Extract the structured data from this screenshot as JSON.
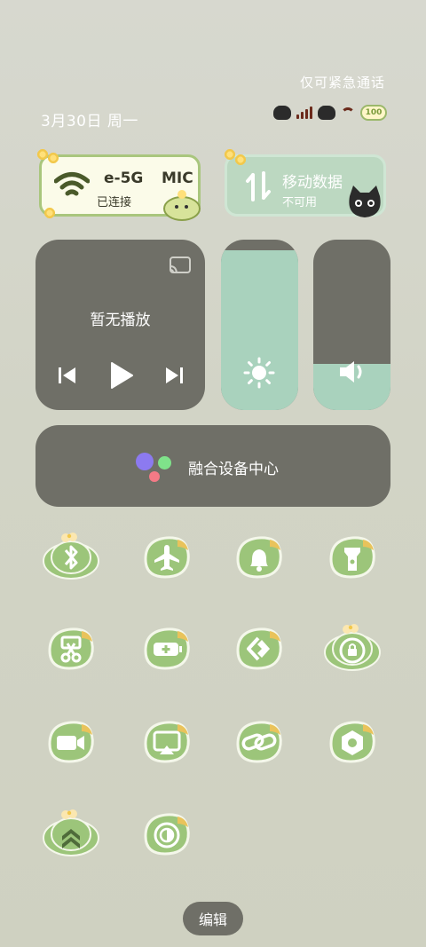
{
  "status_bar": {
    "emergency_text": "仅可紧急通话",
    "date_text": "3月30日 周一",
    "battery_text": "100"
  },
  "wifi_card": {
    "network_name": "e-5G",
    "trailing_text": "MIC",
    "status": "已连接"
  },
  "data_card": {
    "title": "移动数据",
    "status": "不可用"
  },
  "media_player": {
    "title": "暂无播放"
  },
  "sliders": {
    "brightness": {
      "level": 0.94
    },
    "volume": {
      "level": 0.27
    }
  },
  "device_center": {
    "label": "融合设备中心",
    "dot_colors": [
      "#8c7af0",
      "#7fe28a",
      "#f47a86"
    ]
  },
  "tiles": [
    {
      "name": "bluetooth",
      "icon": "bluetooth-icon"
    },
    {
      "name": "airplane-mode",
      "icon": "airplane-icon"
    },
    {
      "name": "ringer",
      "icon": "bell-icon"
    },
    {
      "name": "flashlight",
      "icon": "flashlight-icon"
    },
    {
      "name": "screenshot",
      "icon": "scissors-icon"
    },
    {
      "name": "battery-saver",
      "icon": "battery-icon"
    },
    {
      "name": "nearby-share",
      "icon": "share-arrows-icon"
    },
    {
      "name": "rotation-lock",
      "icon": "rotation-lock-icon"
    },
    {
      "name": "screen-record",
      "icon": "video-camera-icon"
    },
    {
      "name": "screen-cast",
      "icon": "cast-icon"
    },
    {
      "name": "link",
      "icon": "link-icon"
    },
    {
      "name": "settings",
      "icon": "hexagon-settings-icon"
    },
    {
      "name": "performance",
      "icon": "double-chevron-up-icon"
    },
    {
      "name": "dark-mode",
      "icon": "contrast-icon"
    }
  ],
  "edit_button": {
    "label": "编辑"
  },
  "colors": {
    "background": "#d4d6ca",
    "panel": "#6f6f67",
    "accent_green": "#a9d2bd",
    "leaf_green": "#9cc57a",
    "leaf_border": "#f4f7ea"
  }
}
